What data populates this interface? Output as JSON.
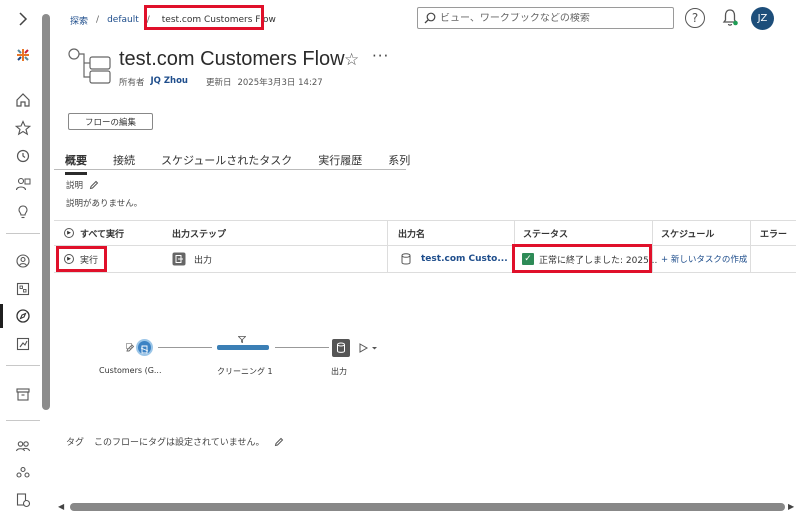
{
  "breadcrumb": {
    "explore": "探索",
    "project": "default",
    "current": "test.com Customers Flow"
  },
  "search": {
    "placeholder": "ビュー、ワークブックなどの検索"
  },
  "user": {
    "initials": "JZ"
  },
  "header": {
    "title": "test.com Customers Flow",
    "owner_label": "所有者",
    "owner_name": "JQ Zhou",
    "updated_label": "更新日",
    "updated_value": "2025年3月3日 14:27",
    "edit_button": "フローの編集"
  },
  "tabs": [
    "概要",
    "接続",
    "スケジュールされたタスク",
    "実行履歴",
    "系列"
  ],
  "description": {
    "label": "説明",
    "text": "説明がありません。"
  },
  "table": {
    "headers": {
      "run_all": "すべて実行",
      "output_step": "出力ステップ",
      "output_name": "出力名",
      "status": "ステータス",
      "schedule": "スケジュール",
      "error": "エラー"
    },
    "row": {
      "run": "実行",
      "output_step": "出力",
      "output_name": "test.com Custo...",
      "status": "正常に終了しました: 2025...",
      "schedule": "+ 新しいタスクの作成"
    }
  },
  "flow": {
    "input": "Customers (G...",
    "clean": "クリーニング 1",
    "output": "出力"
  },
  "tags": {
    "label": "タグ",
    "text": "このフローにタグは設定されていません。"
  },
  "colors": {
    "accent": "#1f4e8c",
    "highlight": "#e0102a",
    "success": "#2e8b57",
    "avatar": "#1d4e7a"
  }
}
